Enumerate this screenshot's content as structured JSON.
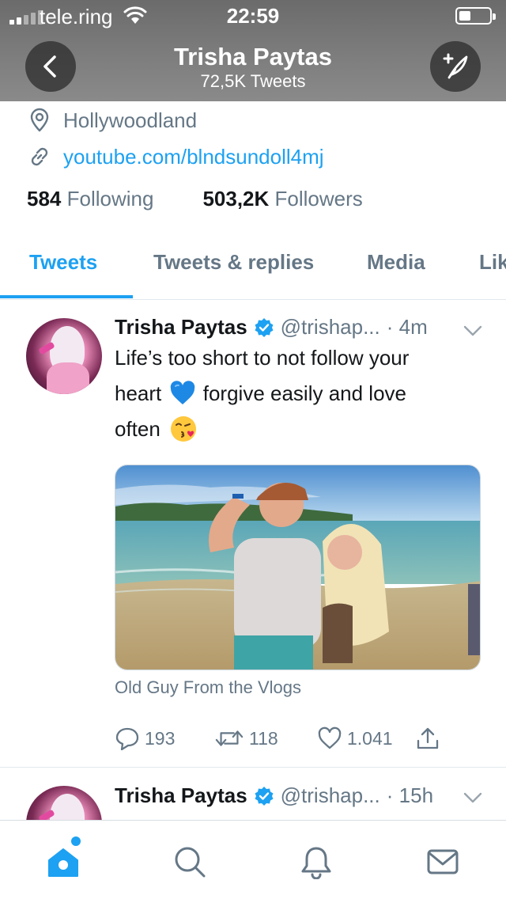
{
  "status_bar": {
    "carrier": "tele.ring",
    "time": "22:59",
    "battery_level": 0.3
  },
  "header": {
    "title": "Trisha Paytas",
    "subtitle": "72,5K Tweets",
    "back_icon": "chevron-left-icon",
    "compose_icon": "feather-plus-icon"
  },
  "profile": {
    "location": "Hollywoodland",
    "link": "youtube.com/blndsundoll4mj",
    "following_count": "584",
    "following_label": "Following",
    "followers_count": "503,2K",
    "followers_label": "Followers"
  },
  "tabs": [
    {
      "label": "Tweets",
      "active": true
    },
    {
      "label": "Tweets & replies",
      "active": false
    },
    {
      "label": "Media",
      "active": false
    },
    {
      "label": "Lik",
      "active": false
    }
  ],
  "tweets": [
    {
      "name": "Trisha Paytas",
      "handle": "@trishap...",
      "time": "· 4m",
      "text_line1": "Life’s too short to not follow your",
      "text_line2a": "heart",
      "text_line2b": "forgive easily and love",
      "text_line3": "often",
      "emojis": [
        "blue-heart-emoji",
        "kissing-face-emoji"
      ],
      "media_caption": "Old Guy From the Vlogs",
      "replies": "193",
      "retweets": "118",
      "likes": "1.041"
    },
    {
      "name": "Trisha Paytas",
      "handle": "@trishap...",
      "time": "· 15h"
    }
  ],
  "tabbar": {
    "items": [
      "home-icon",
      "search-icon",
      "bell-icon",
      "mail-icon"
    ],
    "active": "home-icon"
  },
  "colors": {
    "accent": "#1da1f2",
    "muted": "#657786",
    "text": "#14171a"
  }
}
